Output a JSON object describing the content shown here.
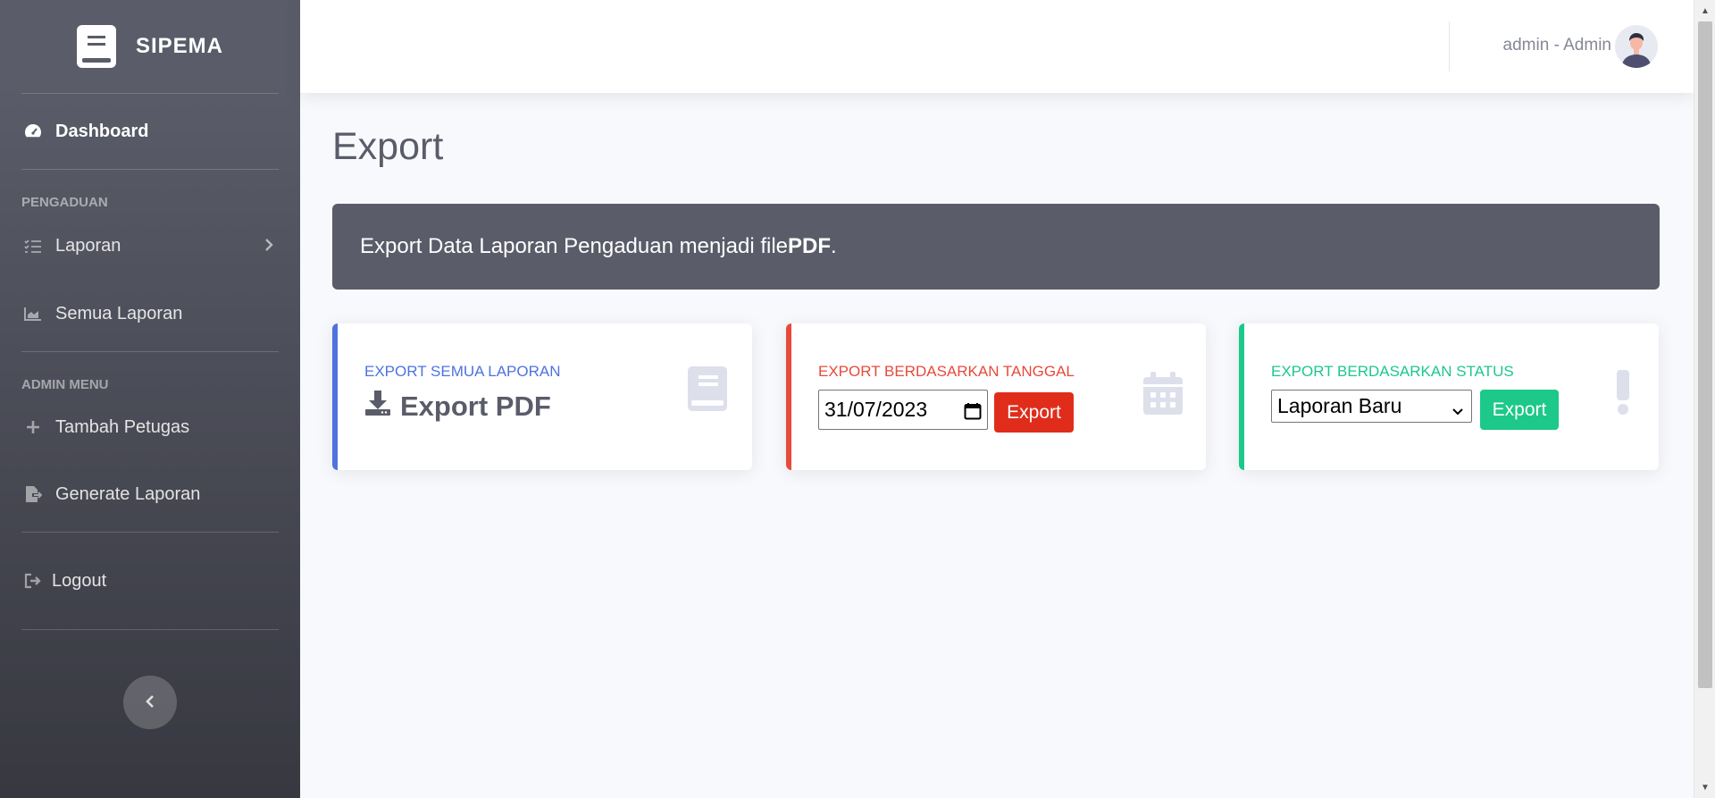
{
  "brand": {
    "name": "SIPEMA",
    "icon": "book-icon"
  },
  "sidebar": {
    "dashboard": {
      "label": "Dashboard",
      "icon": "tachometer-icon"
    },
    "section_pengaduan": "PENGADUAN",
    "laporan": {
      "label": "Laporan",
      "icon": "list-check-icon"
    },
    "semua_laporan": {
      "label": "Semua Laporan",
      "icon": "chart-area-icon"
    },
    "section_admin": "ADMIN MENU",
    "tambah_petugas": {
      "label": "Tambah Petugas",
      "icon": "plus-icon"
    },
    "generate_laporan": {
      "label": "Generate Laporan",
      "icon": "file-export-icon"
    },
    "logout": {
      "label": "Logout",
      "icon": "sign-out-icon"
    }
  },
  "topbar": {
    "user_name": "admin - Admin"
  },
  "page": {
    "title": "Export",
    "alert": {
      "text": "Export Data Laporan Pengaduan menjadi file ",
      "bold": "PDF",
      "end": "."
    }
  },
  "cards": {
    "all": {
      "label": "EXPORT SEMUA LAPORAN",
      "button": "Export PDF",
      "color": "#4e73df"
    },
    "by_date": {
      "label": "EXPORT BERDASARKAN TANGGAL",
      "date_value": "31/07/2023",
      "button": "Export",
      "color": "#e74a3b"
    },
    "by_status": {
      "label": "EXPORT BERDASARKAN STATUS",
      "selected": "Laporan Baru",
      "button": "Export",
      "color": "#1cc88a"
    }
  }
}
